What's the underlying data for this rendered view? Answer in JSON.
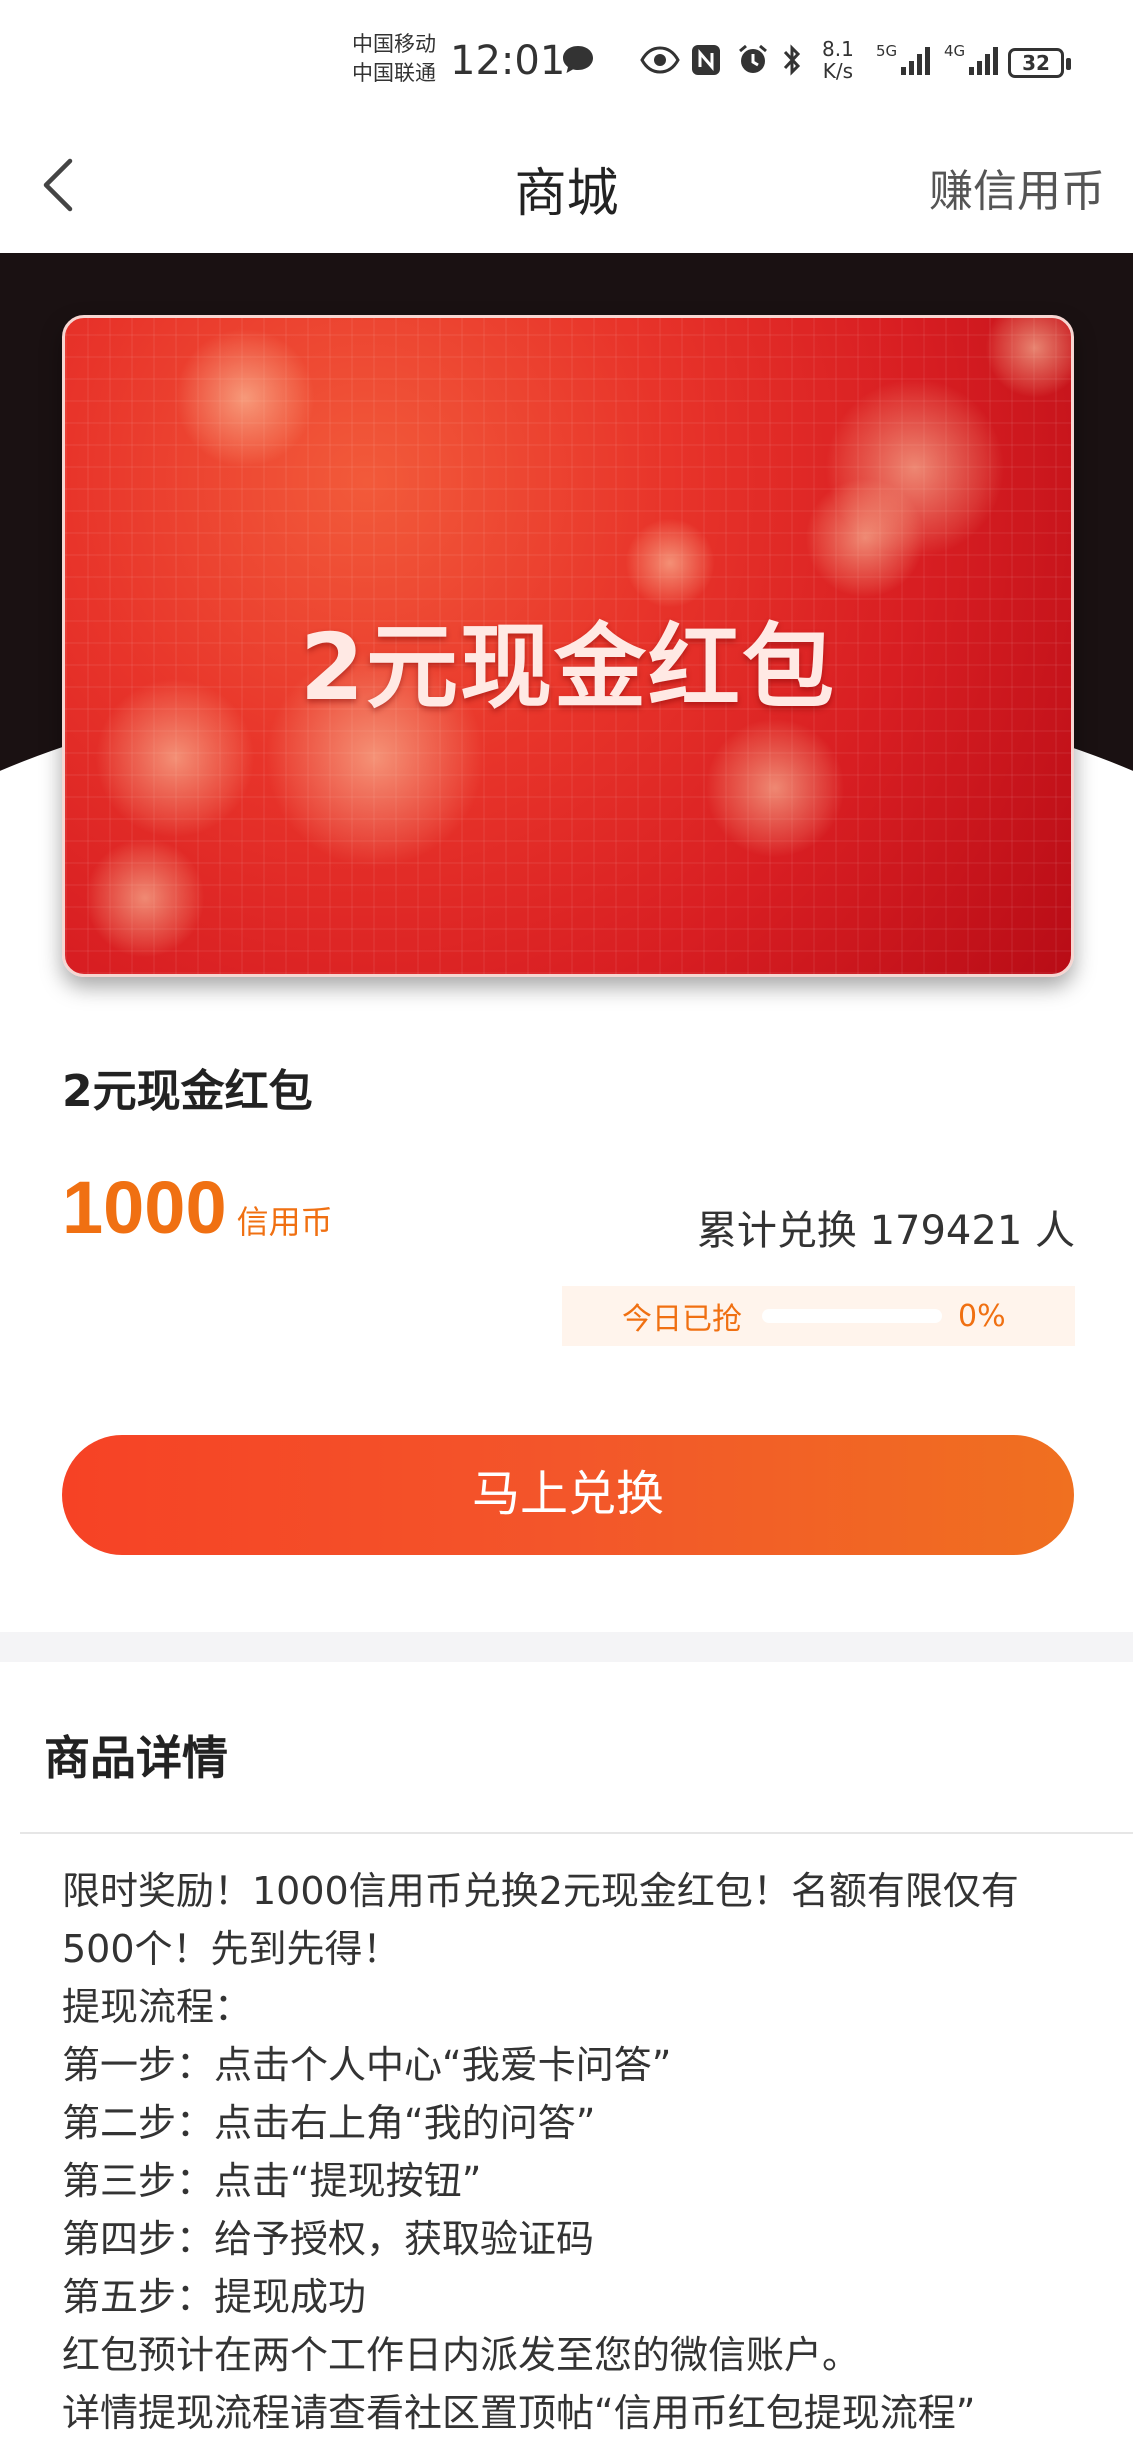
{
  "status_bar": {
    "carrier_1": "中国移动",
    "carrier_2": "中国联通",
    "time": "12:01",
    "net_speed_value": "8.1",
    "net_speed_unit": "K/s",
    "sim1_network": "5G",
    "sim2_network": "4G",
    "battery": "32",
    "icons": [
      "message-icon",
      "eye-comfort-icon",
      "nfc-icon",
      "alarm-icon",
      "bluetooth-icon",
      "signal-icon",
      "signal-icon"
    ]
  },
  "header": {
    "title": "商城",
    "right_action": "赚信用币"
  },
  "product": {
    "card_title": "2元现金红包",
    "name": "2元现金红包",
    "price": "1000",
    "price_unit": "信用币",
    "redeemed_text": "累计兑换 179421 人",
    "today_label": "今日已抢",
    "today_percent_text": "0%",
    "today_progress": 0
  },
  "cta": {
    "label": "马上兑换"
  },
  "details": {
    "heading": "商品详情",
    "lines": [
      "限时奖励！1000信用币兑换2元现金红包！名额有限仅有500个！先到先得！",
      "提现流程：",
      "第一步：点击个人中心“我爱卡问答”",
      "第二步：点击右上角“我的问答”",
      "第三步：点击“提现按钮”",
      "第四步：给予授权，获取验证码",
      "第五步：提现成功",
      "红包预计在两个工作日内派发至您的微信账户。",
      "详情提现流程请查看社区置顶帖“信用币红包提现流程”"
    ]
  },
  "colors": {
    "accent": "#f07012",
    "cta_start": "#f64225",
    "cta_end": "#f07020",
    "card_red": "#d81e22"
  }
}
